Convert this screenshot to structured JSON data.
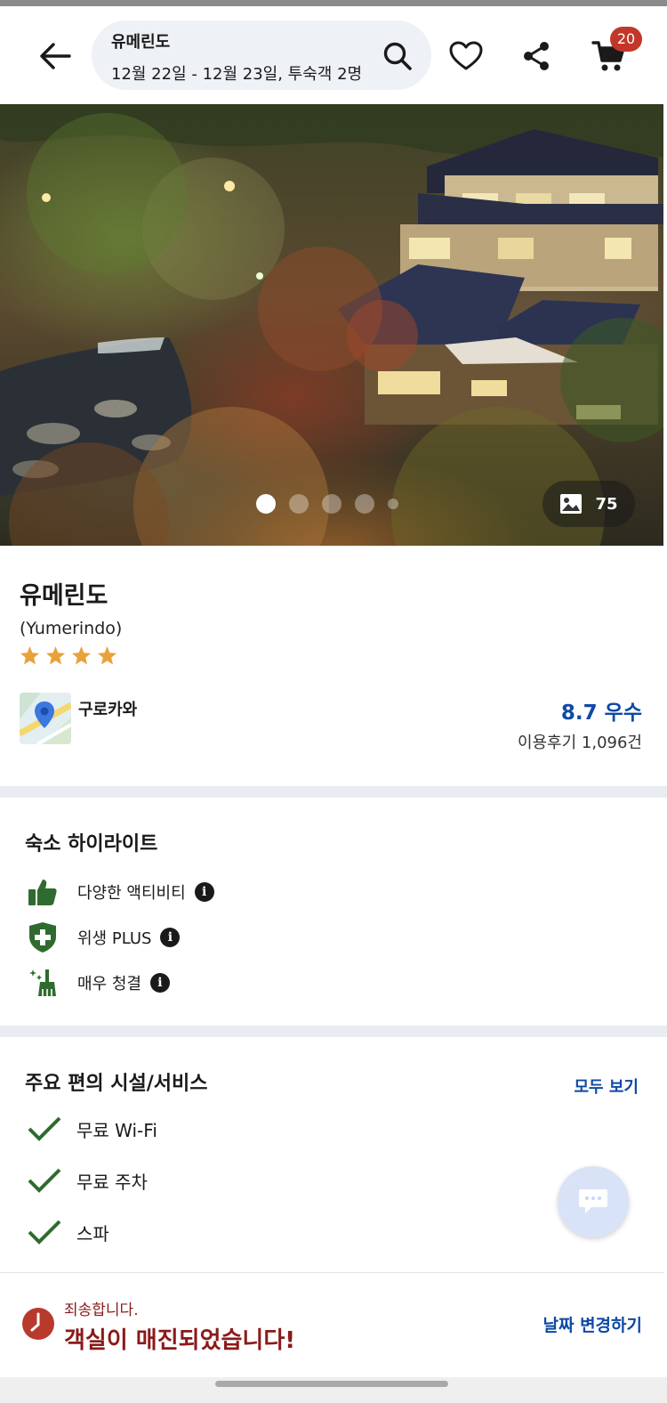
{
  "header": {
    "search_title": "유메린도",
    "search_subtitle": "12월 22일 - 12월 23일, 투숙객 2명",
    "cart_count": "20",
    "icons": [
      "back-arrow-icon",
      "search-icon",
      "heart-icon",
      "share-icon",
      "cart-icon"
    ]
  },
  "gallery": {
    "photo_count": "75",
    "total_dots": 5,
    "active_dot": 1
  },
  "property": {
    "name": "유메린도",
    "name_en": "(Yumerindo)",
    "star_rating": 4,
    "star_color": "#e8a23a",
    "location": "구로카와",
    "score": "8.7 우수",
    "reviews": "이용후기 1,096건"
  },
  "highlights": {
    "title": "숙소 하이라이트",
    "items": [
      {
        "label": "다양한 액티비티",
        "icon": "thumbs-up-icon"
      },
      {
        "label": "위생 PLUS",
        "icon": "shield-plus-icon"
      },
      {
        "label": "매우 청결",
        "icon": "cleaning-icon"
      }
    ],
    "info_glyph": "i",
    "icon_color": "#2f6b2f"
  },
  "facilities": {
    "title": "주요 편의 시설/서비스",
    "see_all": "모두 보기",
    "items": [
      {
        "label": "무료 Wi-Fi"
      },
      {
        "label": "무료 주차"
      },
      {
        "label": "스파"
      }
    ],
    "check_color": "#2f6b2f"
  },
  "footer": {
    "sorry": "죄송합니다.",
    "sold_out": "객실이 매진되었습니다!",
    "change_date": "날짜 변경하기",
    "alert_color": "#8b1a1a",
    "link_color": "#0e49a6"
  }
}
